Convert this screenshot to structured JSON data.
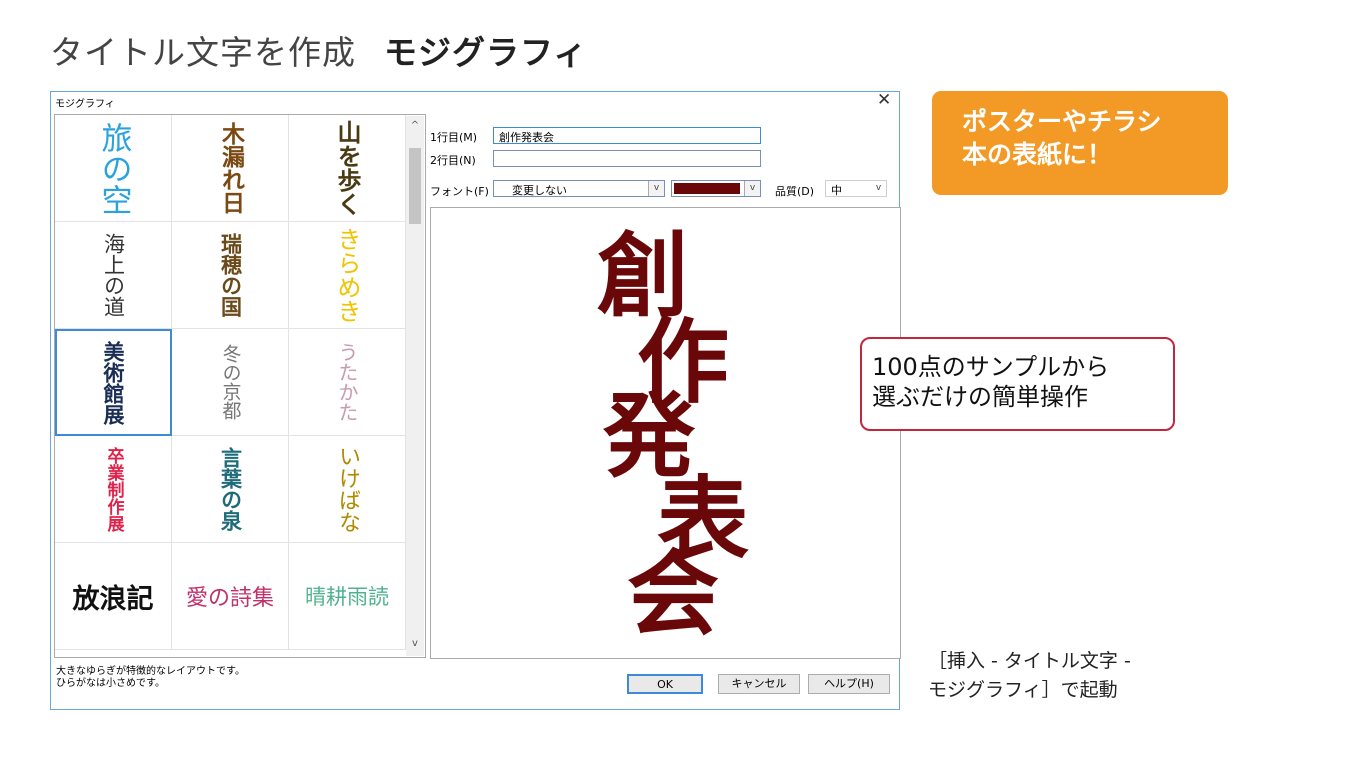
{
  "page": {
    "title": "タイトル文字を作成",
    "title_bold": "モジグラフィ"
  },
  "dialog": {
    "title": "モジグラフィ",
    "close": "✕",
    "gallery": [
      {
        "text": "旅の空",
        "color": "#2aa3dd"
      },
      {
        "text": "木漏れ日",
        "color": "#7a4a12"
      },
      {
        "text": "山を歩く",
        "color": "#4a3a12"
      },
      {
        "text": "海上の道",
        "color": "#333333"
      },
      {
        "text": "瑞穂の国",
        "color": "#6b4a1a"
      },
      {
        "text": "きらめき",
        "color": "#f0c400"
      },
      {
        "text": "美術館展",
        "color": "#1b2d55"
      },
      {
        "text": "冬の京都",
        "color": "#777777"
      },
      {
        "text": "うたかた",
        "color": "#c99bb0"
      },
      {
        "text": "卒業制作展",
        "color": "#e0224a"
      },
      {
        "text": "言葉の泉",
        "color": "#1e6b7a"
      },
      {
        "text": "いけばな",
        "color": "#b08a00"
      },
      {
        "text": "放浪記",
        "color": "#111111"
      },
      {
        "text": "愛の詩集",
        "color": "#c0306a"
      },
      {
        "text": "晴耕雨読",
        "color": "#4fb38f"
      }
    ],
    "scroll_up": "^",
    "scroll_down": "v",
    "line1_label": "1行目(M)",
    "line1_value": "創作発表会",
    "line2_label": "2行目(N)",
    "line2_value": "",
    "font_label": "フォント(F)",
    "font_value": "変更しない",
    "color_value": "#6a0709",
    "quality_label": "品質(D)",
    "quality_value": "中",
    "dropdown_arrow": "v",
    "preview_chars": [
      "創",
      "作",
      "発",
      "表",
      "会"
    ],
    "status_line1": "大きなゆらぎが特徴的なレイアウトです。",
    "status_line2": "ひらがなは小さめです。",
    "ok": "OK",
    "cancel": "キャンセル",
    "help": "ヘルプ(H)"
  },
  "callouts": {
    "orange_line1": "ポスターやチラシ",
    "orange_line2": "本の表紙に！",
    "red_line1": "100点のサンプルから",
    "red_line2": "選ぶだけの簡単操作",
    "launch_line1": "［挿入 - タイトル文字 -",
    "launch_line2": "モジグラフィ］で起動"
  }
}
